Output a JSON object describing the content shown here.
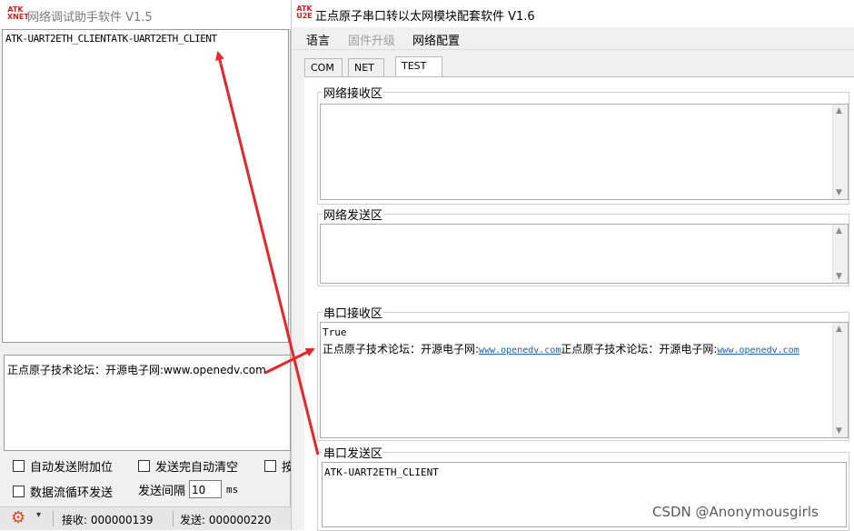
{
  "left_window": {
    "logo_line1": "ATK",
    "logo_line2": "XNET",
    "title": "网络调试助手软件 V1.5",
    "receive_text": "ATK-UART2ETH_CLIENTATK-UART2ETH_CLIENT",
    "send_text": "正点原子技术论坛：开源电子网:www.openedv.com",
    "options": {
      "auto_append": "自动发送附加位",
      "clear_after_send": "发送完自动清空",
      "cutoff_char": "按",
      "loop_send": "数据流循环发送",
      "send_interval_label": "发送间隔",
      "send_interval_value": "10",
      "send_interval_unit": "ms"
    },
    "status": {
      "gear_icon": "gear-icon",
      "dropdown_glyph": "▾",
      "receive": "接收: 000000139",
      "send": "发送: 000000220"
    }
  },
  "right_window": {
    "logo_line1": "ATK",
    "logo_line2": "U2E",
    "title": "正点原子串口转以太网模块配套软件 V1.6",
    "menu": [
      "语言",
      "固件升级",
      "网络配置"
    ],
    "tabs": [
      "COM",
      "NET",
      "TEST"
    ],
    "active_tab": "TEST",
    "groups": {
      "net_receive": {
        "label": "网络接收区",
        "text": ""
      },
      "net_send": {
        "label": "网络发送区",
        "text": ""
      },
      "serial_receive": {
        "label": "串口接收区",
        "line1": "True",
        "line2_prefix": "正点原子技术论坛：开源电子网:",
        "line2_link1": "www.openedv.com",
        "line2_mid": "正点原子技术论坛：开源电子网:",
        "line2_link2": "www.openedv.com"
      },
      "serial_send": {
        "label": "串口发送区",
        "text": "ATK-UART2ETH_CLIENT"
      }
    }
  },
  "watermark": "CSDN @Anonymousgirls",
  "colors": {
    "arrow": "#e8262a",
    "logo": "#d31f1f",
    "link": "#1a5fb4"
  }
}
